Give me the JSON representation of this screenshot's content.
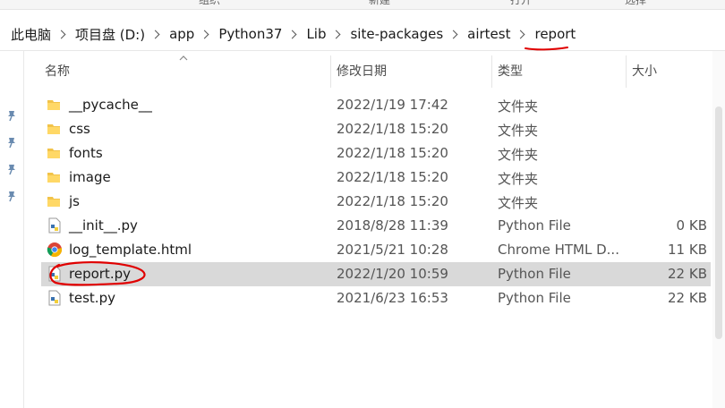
{
  "ribbon": {
    "labels": [
      "组织",
      "新建",
      "打开",
      "选择"
    ]
  },
  "breadcrumb": [
    "此电脑",
    "项目盘 (D:)",
    "app",
    "Python37",
    "Lib",
    "site-packages",
    "airtest",
    "report"
  ],
  "columns": {
    "name": "名称",
    "date": "修改日期",
    "type": "类型",
    "size": "大小"
  },
  "files": [
    {
      "name": "__pycache__",
      "date": "2022/1/19 17:42",
      "type": "文件夹",
      "size": "",
      "icon": "folder-icon"
    },
    {
      "name": "css",
      "date": "2022/1/18 15:20",
      "type": "文件夹",
      "size": "",
      "icon": "folder-icon"
    },
    {
      "name": "fonts",
      "date": "2022/1/18 15:20",
      "type": "文件夹",
      "size": "",
      "icon": "folder-icon"
    },
    {
      "name": "image",
      "date": "2022/1/18 15:20",
      "type": "文件夹",
      "size": "",
      "icon": "folder-icon"
    },
    {
      "name": "js",
      "date": "2022/1/18 15:20",
      "type": "文件夹",
      "size": "",
      "icon": "folder-icon"
    },
    {
      "name": "__init__.py",
      "date": "2018/8/28 11:39",
      "type": "Python File",
      "size": "0 KB",
      "icon": "python-file-icon"
    },
    {
      "name": "log_template.html",
      "date": "2021/5/21 10:28",
      "type": "Chrome HTML D...",
      "size": "11 KB",
      "icon": "chrome-icon"
    },
    {
      "name": "report.py",
      "date": "2022/1/20 10:59",
      "type": "Python File",
      "size": "22 KB",
      "icon": "python-file-icon",
      "selected": true
    },
    {
      "name": "test.py",
      "date": "2021/6/23 16:53",
      "type": "Python File",
      "size": "22 KB",
      "icon": "python-file-icon"
    }
  ],
  "colors": {
    "selection": "#d9d9d9",
    "annotation": "#e00000",
    "folder": "#f2c349"
  }
}
